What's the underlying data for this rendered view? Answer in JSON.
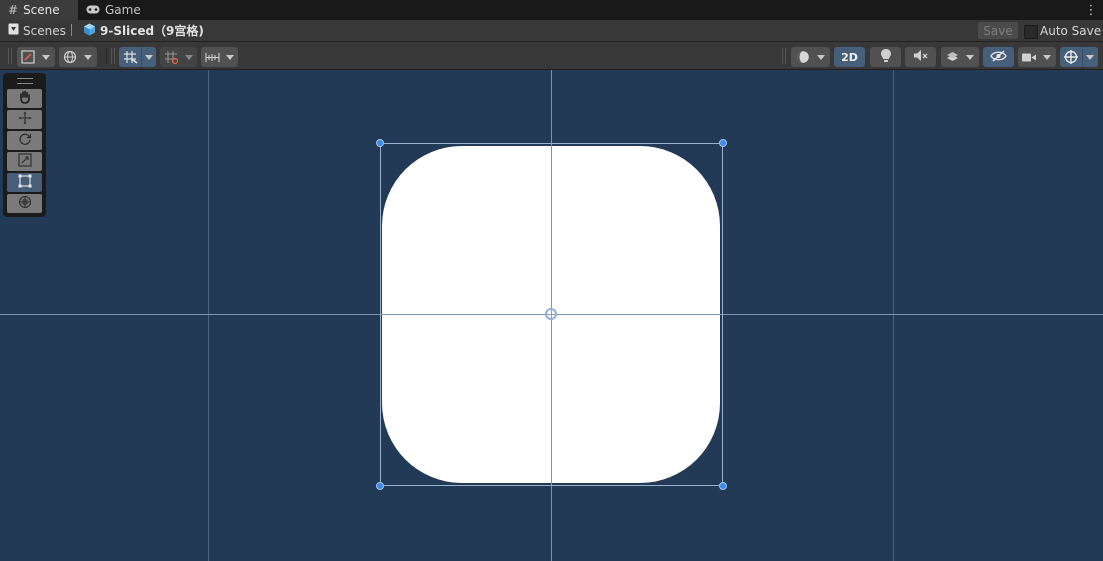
{
  "tabs": [
    {
      "label": "Scene",
      "icon": "hash-icon"
    },
    {
      "label": "Game",
      "icon": "gamepad-icon"
    }
  ],
  "breadcrumb": {
    "root": "Scenes",
    "current": "9-Sliced（9宫格)"
  },
  "header_actions": {
    "save_label": "Save",
    "auto_save_label": "Auto Save",
    "auto_save_checked": false
  },
  "toolbar": {
    "mode_2d_label": "2D",
    "left_tools": [
      "orientation-gizmo-icon",
      "global-pivot-icon",
      "grid-snap-icon",
      "grid-increment-icon",
      "ruler-icon"
    ],
    "right_tools": [
      "shading-mode-icon",
      "2d-toggle",
      "lighting-icon",
      "audio-mute-icon",
      "effects-icon",
      "visibility-icon",
      "camera-icon",
      "gizmos-icon"
    ],
    "active": [
      "grid-snap-icon",
      "2d-toggle",
      "visibility-icon",
      "gizmos-icon"
    ]
  },
  "tool_palette": {
    "tools": [
      "hand-tool",
      "move-tool",
      "rotate-tool",
      "scale-tool",
      "rect-tool",
      "transform-tool"
    ],
    "active": "rect-tool"
  },
  "colors": {
    "viewport_bg": "#223a55",
    "selection_handle": "#3c8be8",
    "sprite": "#ffffff",
    "active_button": "#46607c"
  }
}
